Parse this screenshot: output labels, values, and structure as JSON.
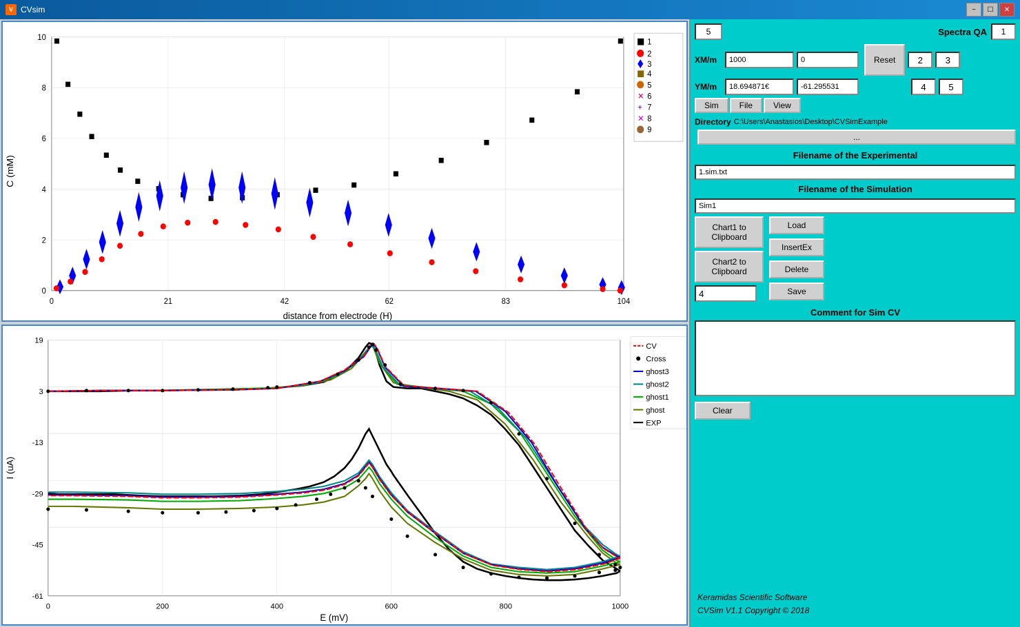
{
  "titleBar": {
    "title": "CVsim",
    "icon": "V",
    "controls": [
      "minimize",
      "maximize",
      "close"
    ]
  },
  "sidebar": {
    "numInput": "5",
    "spectraQaLabel": "Spectra QA",
    "spectraQaValue": "1",
    "xmLabel": "XM/m",
    "xmValue": "1000",
    "xm2Value": "0",
    "ymLabel": "YM/m",
    "ymValue": "18.694871€",
    "ym2Value": "-61.295531",
    "resetLabel": "Reset",
    "num2Value": "2",
    "num3Value": "3",
    "num4Value": "4",
    "num5Value": "5",
    "menuSim": "Sim",
    "menuFile": "File",
    "menuView": "View",
    "dirLabel": "Directory",
    "dirValue": "C:\\Users\\Anastasios\\Desktop\\CVSimExample",
    "browseLabel": "...",
    "expFilenameHeader": "Filename of the Experimental",
    "expFilenameValue": "1.sim.txt",
    "simFilenameHeader": "Filename of the Simulation",
    "simFilenameValue": "Sim1",
    "chart1ClipLabel": "Chart1 to\nClipboard",
    "chart2ClipLabel": "Chart2 to\nClipboard",
    "loadLabel": "Load",
    "insertExLabel": "InsertEx",
    "deleteLabel": "Delete",
    "saveLabel": "Save",
    "simNumValue": "4",
    "commentLabel": "Comment for Sim CV",
    "clearLabel": "Clear",
    "copyright1": "Keramidas Scientific Software",
    "copyright2": "CVSim V1.1 Copyright ©  2018"
  },
  "chart1": {
    "yLabel": "C (mM)",
    "xLabel": "distance from electrode (H)",
    "yMax": 10,
    "yMin": 0,
    "xMax": 104,
    "xTicks": [
      0,
      21,
      42,
      62,
      83,
      104
    ],
    "yTicks": [
      0,
      2,
      4,
      6,
      8,
      10
    ],
    "legend": [
      {
        "label": "1",
        "color": "black",
        "shape": "square"
      },
      {
        "label": "2",
        "color": "red",
        "shape": "circle"
      },
      {
        "label": "3",
        "color": "blue",
        "shape": "diamond"
      },
      {
        "label": "4",
        "color": "#886600",
        "shape": "square"
      },
      {
        "label": "5",
        "color": "#cc6600",
        "shape": "circle"
      },
      {
        "label": "6",
        "color": "#cc0066",
        "shape": "x"
      },
      {
        "label": "7",
        "color": "#6600cc",
        "shape": "plus"
      },
      {
        "label": "8",
        "color": "#cc00cc",
        "shape": "x"
      },
      {
        "label": "9",
        "color": "#996633",
        "shape": "circle"
      }
    ]
  },
  "chart2": {
    "yLabel": "I (uA)",
    "xLabel": "E (mV)",
    "yMax": 19,
    "yMin": -61,
    "xMax": 1000,
    "yTicks": [
      19,
      3,
      -13,
      -29,
      -45,
      -61
    ],
    "xTicks": [
      0,
      200,
      400,
      600,
      800,
      1000
    ],
    "legend": [
      {
        "label": "CV",
        "color": "red",
        "dash": true
      },
      {
        "label": "Cross",
        "color": "black",
        "dots": true
      },
      {
        "label": "ghost3",
        "color": "blue",
        "dash": false
      },
      {
        "label": "ghost2",
        "color": "#008888",
        "dash": false
      },
      {
        "label": "ghost1",
        "color": "green",
        "dash": false
      },
      {
        "label": "ghost",
        "color": "#88aa00",
        "dash": false
      },
      {
        "label": "EXP",
        "color": "black",
        "dash": false
      }
    ]
  }
}
